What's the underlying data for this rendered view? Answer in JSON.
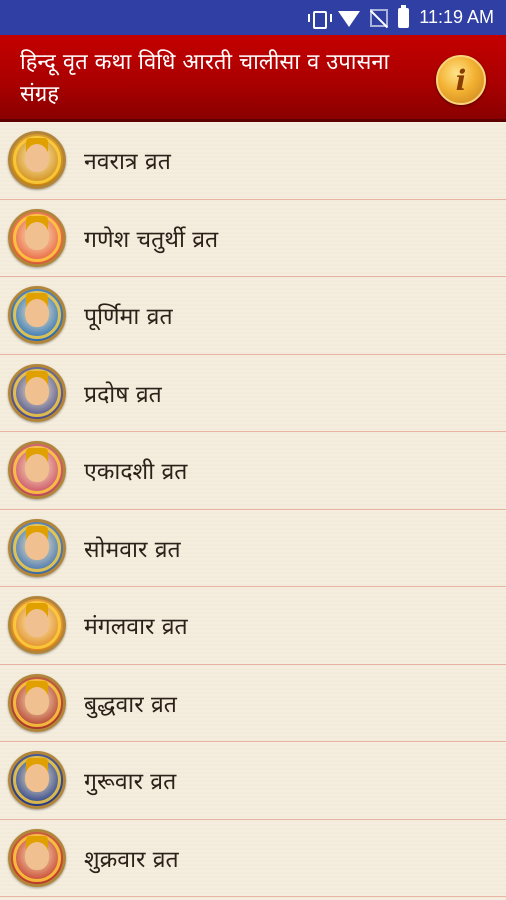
{
  "status_bar": {
    "time": "11:19 AM",
    "icons": [
      "vibrate-icon",
      "wifi-icon",
      "no-signal-icon",
      "battery-icon"
    ]
  },
  "app_bar": {
    "title": "हिन्दू वृत कथा विधि आरती चालीसा व उपासना संग्रह",
    "info_label": "i"
  },
  "list": {
    "items": [
      {
        "label": "नवरात्र व्रत",
        "color": "#d08a10"
      },
      {
        "label": "गणेश चतुर्थी व्रत",
        "color": "#e65f3c"
      },
      {
        "label": "पूर्णिमा व्रत",
        "color": "#2c6fb8"
      },
      {
        "label": "प्रदोष व्रत",
        "color": "#4d4f8f"
      },
      {
        "label": "एकादशी व्रत",
        "color": "#c84b63"
      },
      {
        "label": "सोमवार व्रत",
        "color": "#3f6fb0"
      },
      {
        "label": "मंगलवार व्रत",
        "color": "#e08a1e"
      },
      {
        "label": "बुद्धवार व्रत",
        "color": "#b23a2a"
      },
      {
        "label": "गुरूवार व्रत",
        "color": "#253c8a"
      },
      {
        "label": "शुक्रवार व्रत",
        "color": "#c43c2a"
      }
    ]
  }
}
